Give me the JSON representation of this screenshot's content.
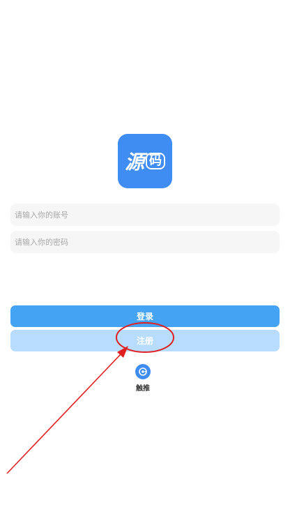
{
  "logo": {
    "glyph_main": "源",
    "glyph_code": "码"
  },
  "form": {
    "account_placeholder": "请输入你的账号",
    "password_placeholder": "请输入你的密码"
  },
  "buttons": {
    "login": "登录",
    "register": "注册"
  },
  "third_party": {
    "label": "触推"
  },
  "colors": {
    "primary": "#45a3f4",
    "primary_light": "#b8dcfb",
    "logo_bg": "#3f8cf2",
    "annotation": "#e02020"
  },
  "icons": [
    "app-logo-icon",
    "touch-push-icon"
  ]
}
